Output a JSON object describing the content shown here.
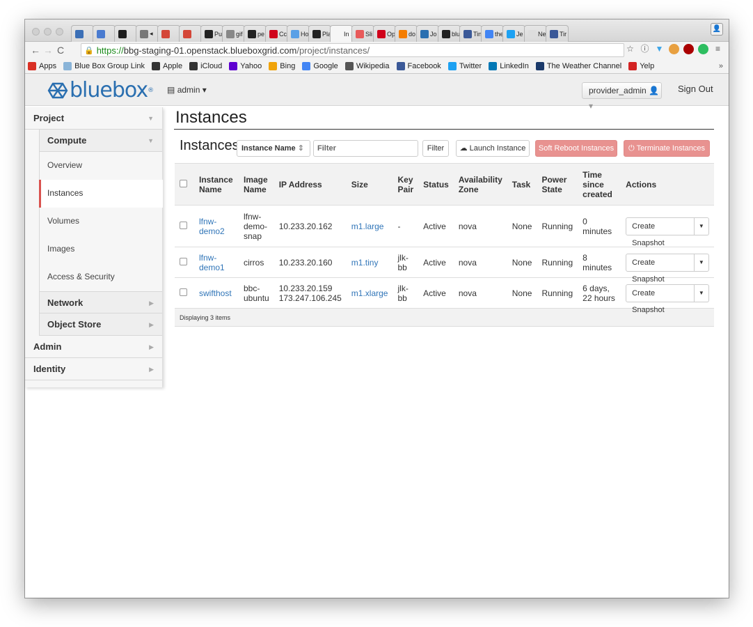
{
  "browser": {
    "tabs": [
      {
        "icon": "trello-icon",
        "color": "#3b6fb6",
        "label": ""
      },
      {
        "icon": "u-icon",
        "color": "#4a7bd0",
        "label": ""
      },
      {
        "icon": "pd-icon",
        "color": "#1d1d1d",
        "label": ""
      },
      {
        "icon": "back-tab-icon",
        "color": "#777",
        "label": "◂"
      },
      {
        "icon": "gmail-icon",
        "color": "#d44638",
        "label": ""
      },
      {
        "icon": "gmail-icon",
        "color": "#d44638",
        "label": ""
      },
      {
        "icon": "github-icon",
        "color": "#222",
        "label": "Pu"
      },
      {
        "icon": "avatar-icon",
        "color": "#888",
        "label": "gif"
      },
      {
        "icon": "github-icon",
        "color": "#222",
        "label": "pe"
      },
      {
        "icon": "red-square-icon",
        "color": "#d0021b",
        "label": "Cc"
      },
      {
        "icon": "grid-icon",
        "color": "#5aa0e6",
        "label": "Ho"
      },
      {
        "icon": "a-icon",
        "color": "#222",
        "label": "Pla"
      },
      {
        "icon": "blank-icon",
        "color": "#f6f6f6",
        "label": "In ×"
      },
      {
        "icon": "s-icon",
        "color": "#e85a5a",
        "label": "Sli"
      },
      {
        "icon": "red-square-icon",
        "color": "#d0021b",
        "label": "Op"
      },
      {
        "icon": "blogger-icon",
        "color": "#f57d00",
        "label": "do"
      },
      {
        "icon": "bluebox-icon",
        "color": "#2a6fb0",
        "label": "Jo"
      },
      {
        "icon": "github-icon",
        "color": "#222",
        "label": "blu"
      },
      {
        "icon": "facebook-icon",
        "color": "#3b5998",
        "label": "Tin"
      },
      {
        "icon": "google-icon",
        "color": "#4285f4",
        "label": "the"
      },
      {
        "icon": "twitter-icon",
        "color": "#1da1f2",
        "label": "Je"
      },
      {
        "icon": "blank-icon",
        "color": "#ddd",
        "label": "New"
      },
      {
        "icon": "facebook-icon",
        "color": "#3b5998",
        "label": "Tir"
      }
    ],
    "url_scheme": "https://",
    "url_host": "bbg-staging-01.openstack.blueboxgrid.com",
    "url_path": "/project/instances/",
    "bookmarks": [
      {
        "icon": "apps-icon",
        "color": "#d93025",
        "label": "Apps"
      },
      {
        "icon": "folder-icon",
        "color": "#8ab4d8",
        "label": "Blue Box Group Link"
      },
      {
        "icon": "apple-icon",
        "color": "#333",
        "label": "Apple"
      },
      {
        "icon": "apple-icon",
        "color": "#333",
        "label": "iCloud"
      },
      {
        "icon": "yahoo-icon",
        "color": "#5f01d1",
        "label": "Yahoo"
      },
      {
        "icon": "bing-icon",
        "color": "#f0a30a",
        "label": "Bing"
      },
      {
        "icon": "google-icon",
        "color": "#4285f4",
        "label": "Google"
      },
      {
        "icon": "wikipedia-icon",
        "color": "#555",
        "label": "Wikipedia"
      },
      {
        "icon": "facebook-icon",
        "color": "#3b5998",
        "label": "Facebook"
      },
      {
        "icon": "twitter-icon",
        "color": "#1da1f2",
        "label": "Twitter"
      },
      {
        "icon": "linkedin-icon",
        "color": "#0077b5",
        "label": "LinkedIn"
      },
      {
        "icon": "weather-icon",
        "color": "#1b3a6b",
        "label": "The Weather Channel"
      },
      {
        "icon": "yelp-icon",
        "color": "#d32323",
        "label": "Yelp"
      }
    ],
    "more": "»"
  },
  "header": {
    "logo_text": "bluebox",
    "project_label": "admin",
    "user_label": "provider_admin",
    "signout_label": "Sign Out"
  },
  "sidebar": {
    "project": "Project",
    "compute": "Compute",
    "items": [
      "Overview",
      "Instances",
      "Volumes",
      "Images",
      "Access & Security"
    ],
    "network": "Network",
    "object_store": "Object Store",
    "admin": "Admin",
    "identity": "Identity"
  },
  "page": {
    "title": "Instances",
    "table_title": "Instances",
    "filter_select": "Instance Name",
    "filter_placeholder": "Filter",
    "filter_button": "Filter",
    "launch_button": "Launch Instance",
    "soft_reboot_button": "Soft Reboot Instances",
    "terminate_button": "Terminate Instances"
  },
  "table": {
    "headers": {
      "name": "Instance Name",
      "image": "Image Name",
      "ip": "IP Address",
      "size": "Size",
      "keypair": "Key Pair",
      "status": "Status",
      "zone": "Availability Zone",
      "task": "Task",
      "power": "Power State",
      "time": "Time since created",
      "actions": "Actions"
    },
    "rows": [
      {
        "name": "lfnw-demo2",
        "image": "lfnw-demo-snap",
        "ip": "10.233.20.162",
        "size": "m1.large",
        "keypair": "-",
        "status": "Active",
        "zone": "nova",
        "task": "None",
        "power": "Running",
        "time": "0 minutes",
        "action": "Create Snapshot"
      },
      {
        "name": "lfnw-demo1",
        "image": "cirros",
        "ip": "10.233.20.160",
        "size": "m1.tiny",
        "keypair": "jlk-bb",
        "status": "Active",
        "zone": "nova",
        "task": "None",
        "power": "Running",
        "time": "8 minutes",
        "action": "Create Snapshot"
      },
      {
        "name": "swifthost",
        "image": "bbc-ubuntu",
        "ip": "10.233.20.159\n173.247.106.245",
        "size": "m1.xlarge",
        "keypair": "jlk-bb",
        "status": "Active",
        "zone": "nova",
        "task": "None",
        "power": "Running",
        "time": "6 days, 22 hours",
        "action": "Create Snapshot"
      }
    ],
    "footer": "Displaying 3 items"
  }
}
